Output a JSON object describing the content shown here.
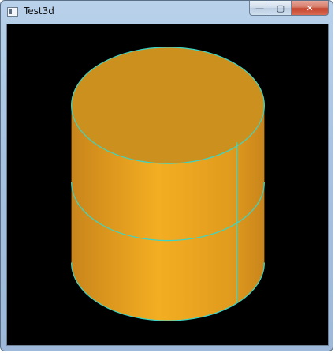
{
  "window": {
    "title": "Test3d",
    "controls": {
      "minimize_glyph": "—",
      "maximize_glyph": "▢",
      "close_glyph": "✕"
    }
  },
  "scene": {
    "object": "cylinder",
    "colors": {
      "background": "#000000",
      "body_light": "#f4ae22",
      "body_mid": "#e19b1e",
      "body_dark": "#c9851b",
      "top_face": "#cc901f",
      "edge": "#3bd6c6"
    }
  }
}
